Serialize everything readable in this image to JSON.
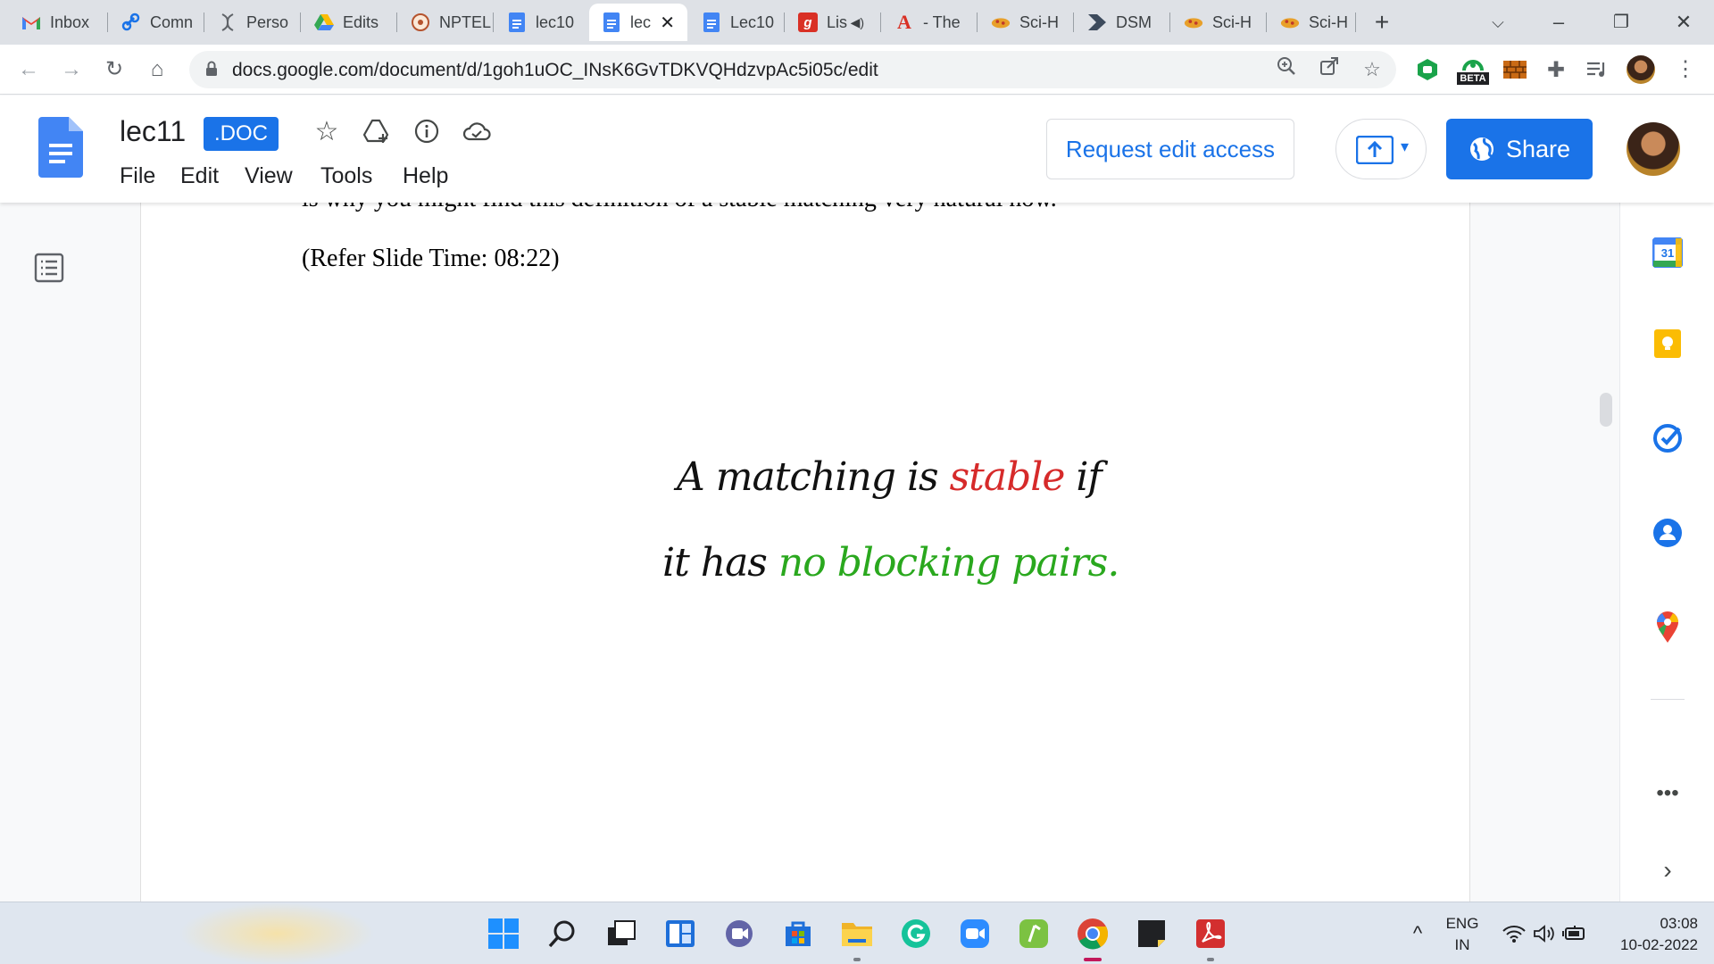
{
  "browser": {
    "tabs": [
      {
        "title": "Inbox",
        "icon": "gmail-icon"
      },
      {
        "title": "Comn",
        "icon": "link-icon"
      },
      {
        "title": "Perso",
        "icon": "dna-icon"
      },
      {
        "title": "Edits",
        "icon": "drive-icon"
      },
      {
        "title": "NPTEL",
        "icon": "nptel-icon"
      },
      {
        "title": "lec10",
        "icon": "docs-icon"
      },
      {
        "title": "lec",
        "icon": "docs-icon",
        "active": true
      },
      {
        "title": "Lec10",
        "icon": "docs-icon"
      },
      {
        "title": "Lis",
        "icon": "g-icon"
      },
      {
        "title": "- The",
        "icon": "acrobat-a-icon"
      },
      {
        "title": "Sci-H",
        "icon": "scihub-icon"
      },
      {
        "title": "DSM",
        "icon": "dsm-icon"
      },
      {
        "title": "Sci-H",
        "icon": "scihub-icon"
      },
      {
        "title": "Sci-H",
        "icon": "scihub-icon"
      }
    ],
    "url": "docs.google.com/document/d/1goh1uOC_INsK6GvTDKVQHdzvpAc5i05c/edit",
    "beta_badge": "BETA"
  },
  "docs": {
    "title": "lec11",
    "badge": ".DOC",
    "menu": [
      "File",
      "Edit",
      "View",
      "Tools",
      "Help"
    ],
    "request_edit": "Request edit access",
    "share": "Share"
  },
  "document": {
    "partial_line": "is why you might find this definition of a stable matching very natural now.",
    "refer_slide": "(Refer Slide Time: 08:22)",
    "slide": {
      "line1": [
        "A matching is ",
        "stable",
        " if"
      ],
      "line2": [
        "it has ",
        "no blocking pairs."
      ]
    },
    "colors": {
      "stable": "#d62a2a",
      "no_blocking": "#2aa81e"
    }
  },
  "sidepanel": {
    "calendar_day": "31"
  },
  "taskbar": {
    "lang_top": "ENG",
    "lang_bottom": "IN",
    "time": "03:08",
    "date": "10-02-2022"
  }
}
